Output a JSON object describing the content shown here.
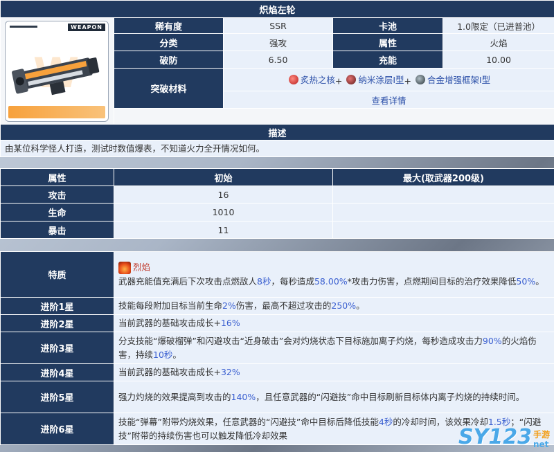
{
  "weapon": {
    "name": "炽焰左轮",
    "card_tag": "WEAPON",
    "rarity_label": "稀有度",
    "rarity": "SSR",
    "pool_label": "卡池",
    "pool": "1.0限定（已进普池）",
    "category_label": "分类",
    "category": "强攻",
    "attribute_label": "属性",
    "attribute": "火焰",
    "break_label": "破防",
    "break": "6.50",
    "charge_label": "充能",
    "charge": "10.00",
    "material_label": "突破材料",
    "materials": [
      "炙热之核",
      "纳米涂层Ⅰ型",
      "合金增强框架Ⅰ型"
    ],
    "material_sep": "+",
    "detail_link": "查看详情"
  },
  "desc": {
    "title": "描述",
    "text": "由某位科学怪人打造，测试时数值爆表，不知道火力全开情况如何。"
  },
  "stats": {
    "headers": [
      "属性",
      "初始",
      "最大(取武器200级)"
    ],
    "rows": [
      {
        "name": "攻击",
        "init": "16",
        "max": ""
      },
      {
        "name": "生命",
        "init": "1010",
        "max": ""
      },
      {
        "name": "暴击",
        "init": "11",
        "max": ""
      }
    ]
  },
  "traits": {
    "trait_label": "特质",
    "trait_name": "烈焰",
    "trait_parts": [
      "武器充能值充满后下次攻击点燃敌人",
      "8秒",
      "，每秒造成",
      "58.00%",
      "*攻击力伤害，点燃期间目标的治疗效果降低",
      "50%",
      "。"
    ],
    "levels": [
      {
        "label": "进阶1星",
        "parts": [
          "技能每段附加目标当前生命",
          "2%",
          "伤害，最高不超过攻击的",
          "250%",
          "。"
        ]
      },
      {
        "label": "进阶2星",
        "parts": [
          "当前武器的基础攻击成长+",
          "16%"
        ]
      },
      {
        "label": "进阶3星",
        "parts": [
          "分支技能“爆破榴弹”和闪避攻击“近身破击”会对灼烧状态下目标施加离子灼烧，每秒造成攻击力",
          "90%",
          "的火焰伤害，持续",
          "10秒",
          "。"
        ]
      },
      {
        "label": "进阶4星",
        "parts": [
          "当前武器的基础攻击成长+",
          "32%"
        ]
      },
      {
        "label": "进阶5星",
        "parts": [
          "强力灼烧的效果提高到攻击的",
          "140%",
          "，且任意武器的“闪避技”命中目标刷新目标体内离子灼烧的持续时间。"
        ]
      },
      {
        "label": "进阶6星",
        "parts": [
          "技能“弹幕”附带灼烧效果，任意武器的“闪避技”命中目标后降低技能",
          "4秒",
          "的冷却时间，该效果冷却",
          "1.5秒",
          "；“闪避技”附带的持续伤害也可以触发降低冷却效果"
        ]
      }
    ]
  },
  "watermark": {
    "text": "SY123",
    "sub1": "手游",
    "sub2": "net"
  },
  "colors": {
    "header_bg": "#213a5f",
    "cell_bg": "#e9f0fa",
    "highlight": "#3a5fd0",
    "trait_name": "#c0392b"
  }
}
